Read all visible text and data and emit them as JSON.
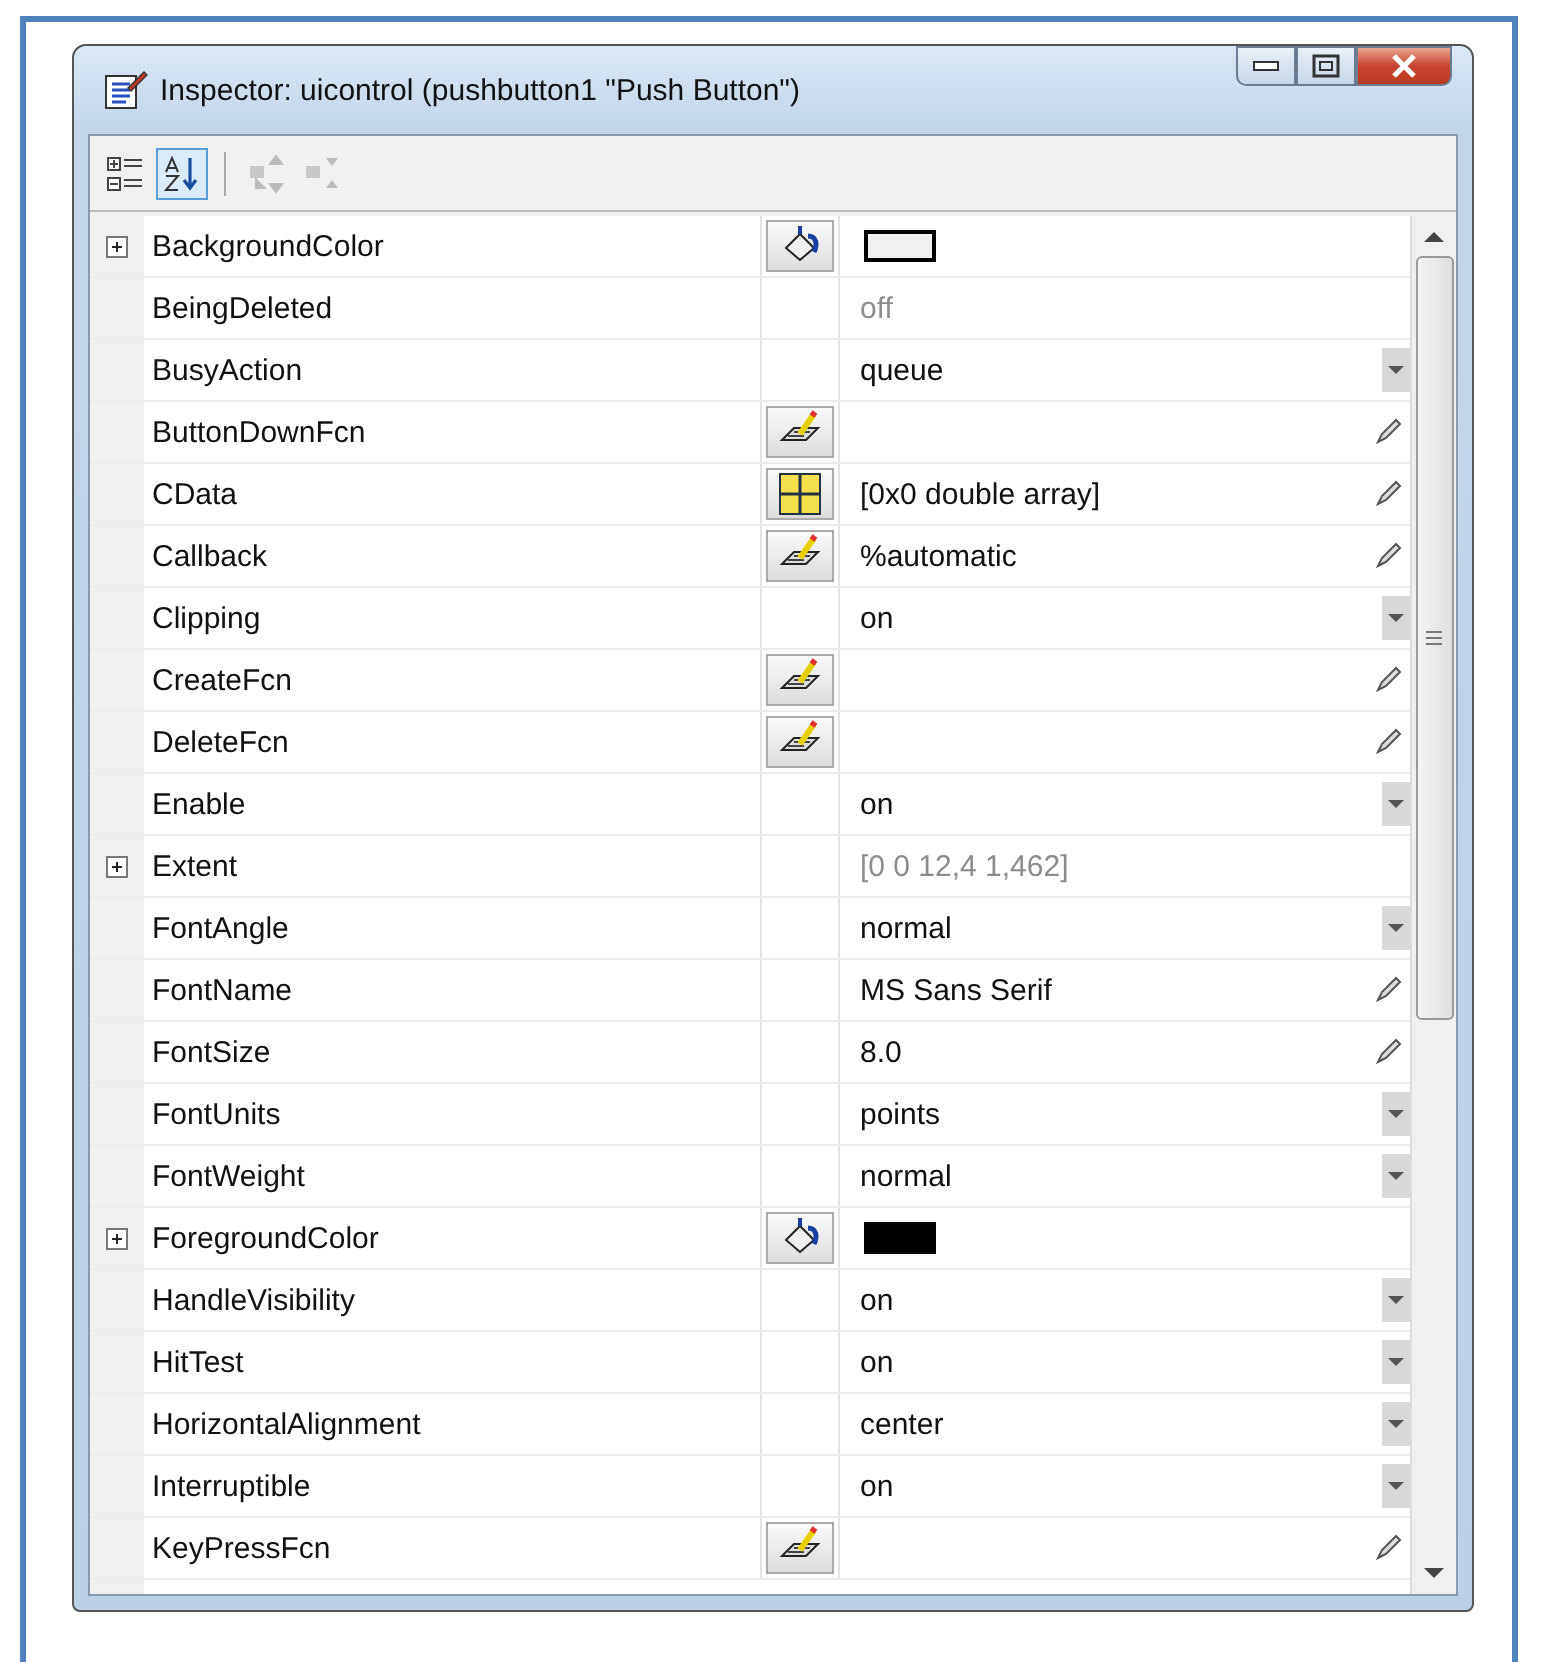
{
  "window": {
    "title": "Inspector:  uicontrol (pushbutton1 \"Push Button\")"
  },
  "toolbar": [
    {
      "kind": "categorized",
      "selected": false,
      "disabled": false
    },
    {
      "kind": "alpha",
      "selected": true,
      "disabled": false
    },
    {
      "kind": "expand",
      "selected": false,
      "disabled": true
    },
    {
      "kind": "collapse",
      "selected": false,
      "disabled": true
    }
  ],
  "properties": [
    {
      "name": "BackgroundColor",
      "kind": "color",
      "expandable": true,
      "dropdown": false,
      "editable": false,
      "color": "#f0f0f0"
    },
    {
      "name": "BeingDeleted",
      "kind": "plain",
      "expandable": false,
      "dropdown": false,
      "editable": false,
      "value": "off",
      "disabled": true
    },
    {
      "name": "BusyAction",
      "kind": "plain",
      "expandable": false,
      "dropdown": true,
      "editable": false,
      "value": "queue"
    },
    {
      "name": "ButtonDownFcn",
      "kind": "callback",
      "expandable": false,
      "dropdown": false,
      "editable": true
    },
    {
      "name": "CData",
      "kind": "array",
      "expandable": false,
      "dropdown": false,
      "editable": true,
      "value": "[0x0  double array]"
    },
    {
      "name": "Callback",
      "kind": "callback",
      "expandable": false,
      "dropdown": false,
      "editable": true,
      "value": "%automatic"
    },
    {
      "name": "Clipping",
      "kind": "plain",
      "expandable": false,
      "dropdown": true,
      "editable": false,
      "value": "on"
    },
    {
      "name": "CreateFcn",
      "kind": "callback",
      "expandable": false,
      "dropdown": false,
      "editable": true
    },
    {
      "name": "DeleteFcn",
      "kind": "callback",
      "expandable": false,
      "dropdown": false,
      "editable": true
    },
    {
      "name": "Enable",
      "kind": "plain",
      "expandable": false,
      "dropdown": true,
      "editable": false,
      "value": "on"
    },
    {
      "name": "Extent",
      "kind": "plain",
      "expandable": true,
      "dropdown": false,
      "editable": false,
      "value": "[0 0 12,4 1,462]",
      "disabled": true
    },
    {
      "name": "FontAngle",
      "kind": "plain",
      "expandable": false,
      "dropdown": true,
      "editable": false,
      "value": "normal"
    },
    {
      "name": "FontName",
      "kind": "plain",
      "expandable": false,
      "dropdown": false,
      "editable": true,
      "value": "MS Sans Serif"
    },
    {
      "name": "FontSize",
      "kind": "plain",
      "expandable": false,
      "dropdown": false,
      "editable": true,
      "value": "8.0"
    },
    {
      "name": "FontUnits",
      "kind": "plain",
      "expandable": false,
      "dropdown": true,
      "editable": false,
      "value": "points"
    },
    {
      "name": "FontWeight",
      "kind": "plain",
      "expandable": false,
      "dropdown": true,
      "editable": false,
      "value": "normal"
    },
    {
      "name": "ForegroundColor",
      "kind": "color",
      "expandable": true,
      "dropdown": false,
      "editable": false,
      "color": "#000000"
    },
    {
      "name": "HandleVisibility",
      "kind": "plain",
      "expandable": false,
      "dropdown": true,
      "editable": false,
      "value": "on"
    },
    {
      "name": "HitTest",
      "kind": "plain",
      "expandable": false,
      "dropdown": true,
      "editable": false,
      "value": "on"
    },
    {
      "name": "HorizontalAlignment",
      "kind": "plain",
      "expandable": false,
      "dropdown": true,
      "editable": false,
      "value": "center"
    },
    {
      "name": "Interruptible",
      "kind": "plain",
      "expandable": false,
      "dropdown": true,
      "editable": false,
      "value": "on"
    },
    {
      "name": "KeyPressFcn",
      "kind": "callback",
      "expandable": false,
      "dropdown": false,
      "editable": true
    }
  ]
}
